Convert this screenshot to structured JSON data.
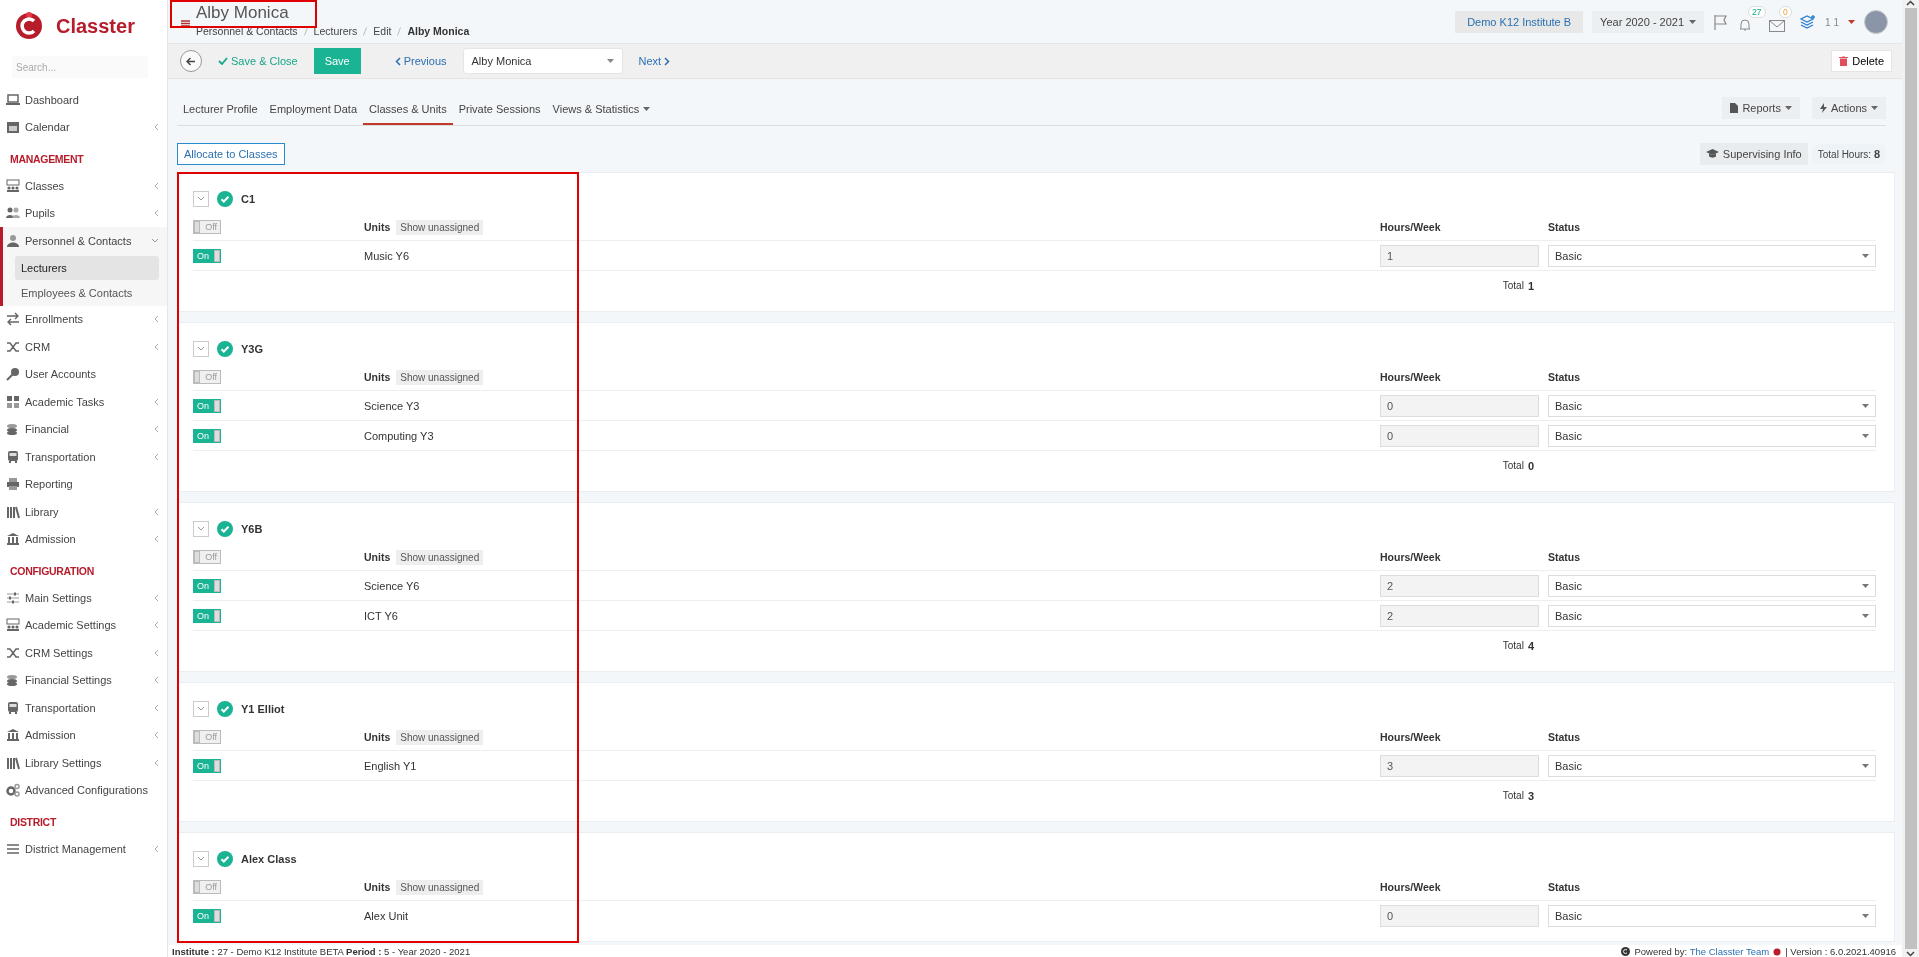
{
  "sidebar": {
    "logo": "Classter",
    "search": {
      "placeholder": "Search..."
    },
    "nav": [
      {
        "kind": "link",
        "label": "Dashboard"
      },
      {
        "kind": "link",
        "label": "Calendar",
        "expanded": false
      },
      {
        "kind": "heading",
        "label": "MANAGEMENT"
      },
      {
        "kind": "link",
        "label": "Classes",
        "expanded": false
      },
      {
        "kind": "link",
        "label": "Pupils",
        "expanded": false
      },
      {
        "kind": "link",
        "label": "Personnel & Contacts",
        "expanded": true,
        "children": [
          {
            "label": "Lecturers",
            "selected": true
          },
          {
            "label": "Employees & Contacts",
            "selected": false
          }
        ]
      },
      {
        "kind": "link",
        "label": "Enrollments",
        "expanded": false
      },
      {
        "kind": "link",
        "label": "CRM",
        "expanded": false
      },
      {
        "kind": "link",
        "label": "User Accounts"
      },
      {
        "kind": "link",
        "label": "Academic Tasks",
        "expanded": false
      },
      {
        "kind": "link",
        "label": "Financial",
        "expanded": false
      },
      {
        "kind": "link",
        "label": "Transportation",
        "expanded": false
      },
      {
        "kind": "link",
        "label": "Reporting"
      },
      {
        "kind": "link",
        "label": "Library",
        "expanded": false
      },
      {
        "kind": "link",
        "label": "Admission",
        "expanded": false
      },
      {
        "kind": "heading",
        "label": "CONFIGURATION"
      },
      {
        "kind": "link",
        "label": "Main Settings",
        "expanded": false
      },
      {
        "kind": "link",
        "label": "Academic Settings",
        "expanded": false
      },
      {
        "kind": "link",
        "label": "CRM Settings",
        "expanded": false
      },
      {
        "kind": "link",
        "label": "Financial Settings",
        "expanded": false
      },
      {
        "kind": "link",
        "label": "Transportation",
        "expanded": false
      },
      {
        "kind": "link",
        "label": "Admission",
        "expanded": false
      },
      {
        "kind": "link",
        "label": "Library Settings",
        "expanded": false
      },
      {
        "kind": "link",
        "label": "Advanced Configurations"
      },
      {
        "kind": "heading",
        "label": "DISTRICT"
      },
      {
        "kind": "link",
        "label": "District Management",
        "expanded": false
      }
    ]
  },
  "header": {
    "title": "Alby Monica",
    "breadcrumb": [
      "Personnel & Contacts",
      "Lecturers",
      "Edit",
      "Alby Monica"
    ],
    "institute": "Demo K12 Institute B",
    "year": "Year 2020 - 2021",
    "notifications": "27",
    "messages": "0",
    "user": "1 1"
  },
  "toolbar": {
    "save_close": "Save & Close",
    "save": "Save",
    "previous": "Previous",
    "record": "Alby Monica",
    "next": "Next",
    "delete": "Delete"
  },
  "tabs": [
    {
      "label": "Lecturer Profile",
      "selected": false
    },
    {
      "label": "Employment Data",
      "selected": false
    },
    {
      "label": "Classes & Units",
      "selected": true
    },
    {
      "label": "Private Sessions",
      "selected": false
    },
    {
      "label": "Views & Statistics",
      "selected": false,
      "dropdown": true
    }
  ],
  "tab_actions": [
    "Reports",
    "Actions"
  ],
  "allocate": "Allocate to Classes",
  "supervising": "Supervising Info",
  "total_hours": {
    "label": "Total Hours:",
    "value": "8"
  },
  "classes": [
    {
      "name": "C1",
      "labels": {
        "units": "Units",
        "show_unassigned": "Show unassigned",
        "hours": "Hours/Week",
        "status": "Status",
        "total": "Total"
      },
      "checked": true,
      "expanded": true,
      "all_toggle": {
        "on": false,
        "label": "Off"
      },
      "units": [
        {
          "name": "Music Y6",
          "on": true,
          "toggle_label": "On",
          "hours": "1",
          "status": "Basic"
        }
      ],
      "total": "1"
    },
    {
      "name": "Y3G",
      "labels": {
        "units": "Units",
        "show_unassigned": "Show unassigned",
        "hours": "Hours/Week",
        "status": "Status",
        "total": "Total"
      },
      "checked": true,
      "expanded": true,
      "all_toggle": {
        "on": false,
        "label": "Off"
      },
      "units": [
        {
          "name": "Science Y3",
          "on": true,
          "toggle_label": "On",
          "hours": "0",
          "status": "Basic"
        },
        {
          "name": "Computing Y3",
          "on": true,
          "toggle_label": "On",
          "hours": "0",
          "status": "Basic"
        }
      ],
      "total": "0"
    },
    {
      "name": "Y6B",
      "labels": {
        "units": "Units",
        "show_unassigned": "Show unassigned",
        "hours": "Hours/Week",
        "status": "Status",
        "total": "Total"
      },
      "checked": true,
      "expanded": true,
      "all_toggle": {
        "on": false,
        "label": "Off"
      },
      "units": [
        {
          "name": "Science Y6",
          "on": true,
          "toggle_label": "On",
          "hours": "2",
          "status": "Basic"
        },
        {
          "name": "ICT Y6",
          "on": true,
          "toggle_label": "On",
          "hours": "2",
          "status": "Basic"
        }
      ],
      "total": "4"
    },
    {
      "name": "Y1 Elliot",
      "labels": {
        "units": "Units",
        "show_unassigned": "Show unassigned",
        "hours": "Hours/Week",
        "status": "Status",
        "total": "Total"
      },
      "checked": true,
      "expanded": true,
      "all_toggle": {
        "on": false,
        "label": "Off"
      },
      "units": [
        {
          "name": "English Y1",
          "on": true,
          "toggle_label": "On",
          "hours": "3",
          "status": "Basic"
        }
      ],
      "total": "3"
    },
    {
      "name": "Alex Class",
      "labels": {
        "units": "Units",
        "show_unassigned": "Show unassigned",
        "hours": "Hours/Week",
        "status": "Status"
      },
      "checked": true,
      "expanded": true,
      "all_toggle": {
        "on": false,
        "label": "Off"
      },
      "units": [
        {
          "name": "Alex Unit",
          "on": true,
          "toggle_label": "On",
          "hours": "0",
          "status": "Basic"
        }
      ]
    }
  ],
  "footer": {
    "info": "**Institute :** 27 - Demo K12 Institute BETA **Period :** 5 - Year 2020 - 2021",
    "powered_by": "Powered by:",
    "team_link": "The Classter Team",
    "version": "| Version : 6.0.2021.40916"
  }
}
